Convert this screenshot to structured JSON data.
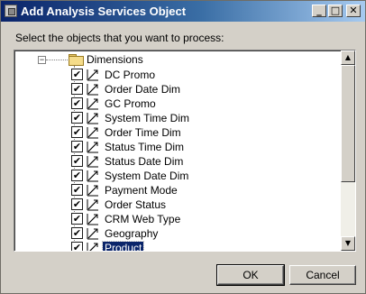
{
  "window": {
    "title": "Add Analysis Services Object",
    "caption_buttons": {
      "minimize": "_",
      "maximize": "□",
      "close": "✕"
    }
  },
  "prompt": "Select the objects that you want to process:",
  "tree": {
    "root": {
      "label": "Dimensions",
      "expander": "−",
      "icon": "folder-icon"
    },
    "items": [
      {
        "label": "DC Promo",
        "checked": true
      },
      {
        "label": "Order Date Dim",
        "checked": true
      },
      {
        "label": "GC Promo",
        "checked": true
      },
      {
        "label": "System Time Dim",
        "checked": true
      },
      {
        "label": "Order Time Dim",
        "checked": true
      },
      {
        "label": "Status Time Dim",
        "checked": true
      },
      {
        "label": "Status Date Dim",
        "checked": true
      },
      {
        "label": "System Date Dim",
        "checked": true
      },
      {
        "label": "Payment Mode",
        "checked": true
      },
      {
        "label": "Order Status",
        "checked": true
      },
      {
        "label": "CRM Web Type",
        "checked": true
      },
      {
        "label": "Geography",
        "checked": true
      },
      {
        "label": "Product",
        "checked": true,
        "selected": true
      }
    ],
    "check_glyph": "✔",
    "item_icon": "dimension-icon"
  },
  "scrollbar": {
    "up": "▲",
    "down": "▼"
  },
  "buttons": {
    "ok": "OK",
    "cancel": "Cancel"
  }
}
